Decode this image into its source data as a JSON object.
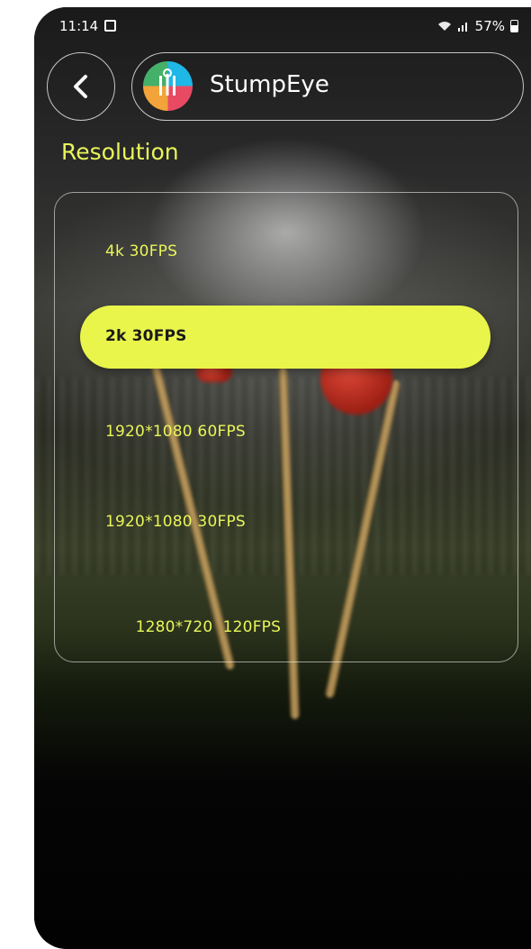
{
  "status_bar": {
    "time": "11:14",
    "battery": "57%",
    "icons": [
      "gallery-notification-icon",
      "wifi-icon",
      "signal-icon",
      "battery-icon"
    ]
  },
  "header": {
    "back_icon": "chevron-left-icon",
    "app_name": "StumpEye",
    "logo_icon": "app-logo-icon"
  },
  "section": {
    "title": "Resolution"
  },
  "resolutions": [
    {
      "label": "4k 30FPS",
      "selected": false
    },
    {
      "label": "2k 30FPS",
      "selected": true
    },
    {
      "label": "1920*1080 60FPS",
      "selected": false
    },
    {
      "label": "1920*1080 30FPS",
      "selected": false
    },
    {
      "label": "1280*720  120FPS",
      "selected": false
    }
  ],
  "colors": {
    "accent": "#e9f54a",
    "text_accent": "#e9f55a",
    "background": "#050505",
    "selected_text": "#1a1a1a"
  }
}
